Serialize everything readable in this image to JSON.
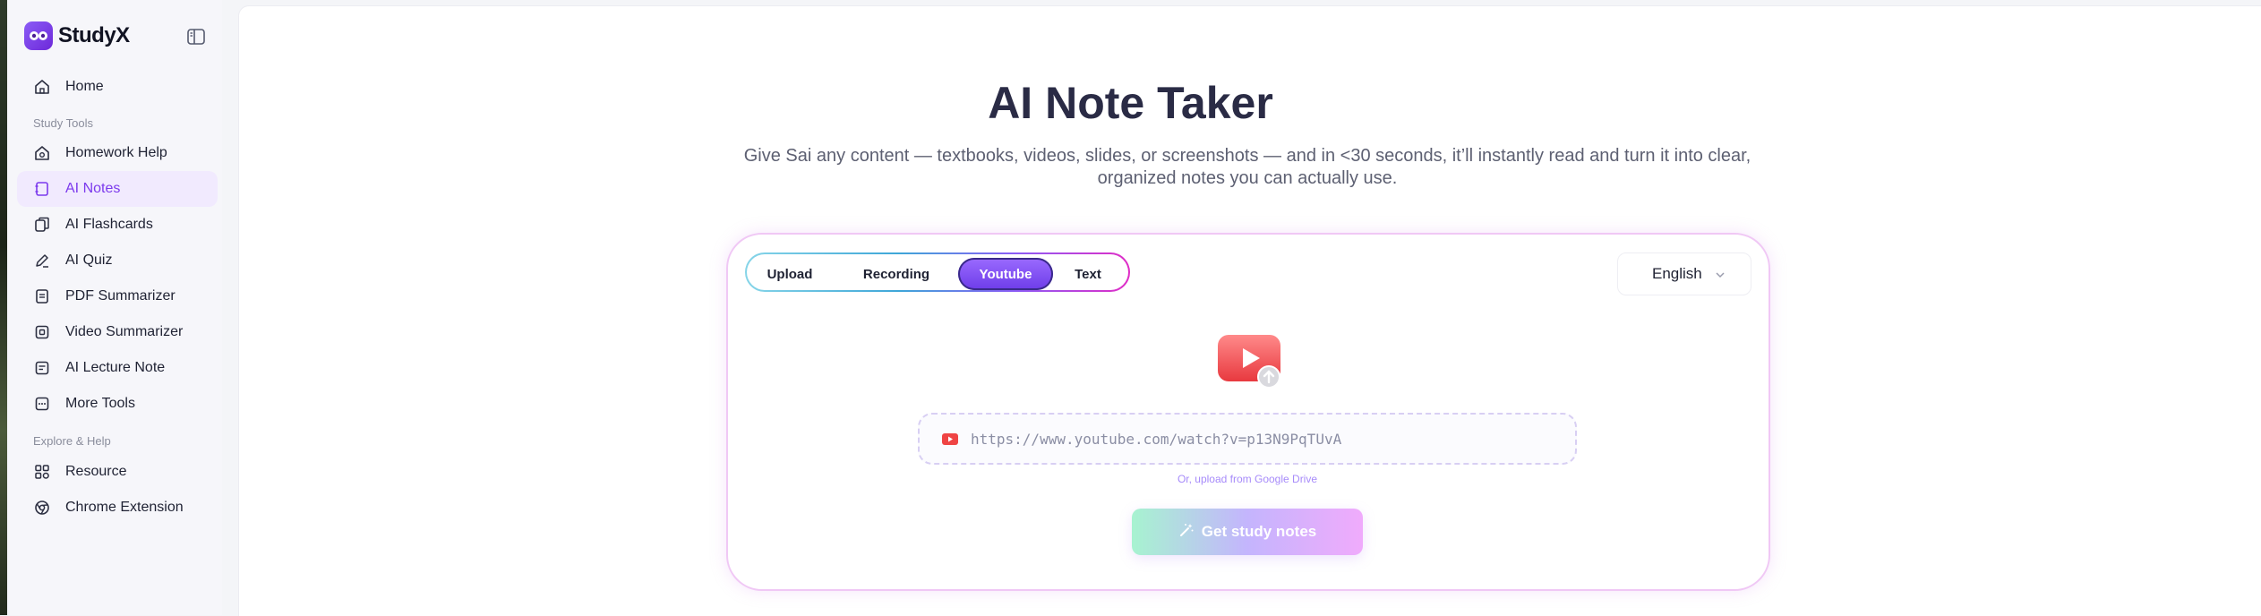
{
  "app": {
    "name": "StudyX"
  },
  "sidebar": {
    "items_top": [
      {
        "label": "Home",
        "icon": "home-icon"
      }
    ],
    "section_study": "Study Tools",
    "items_study": [
      {
        "label": "Homework Help",
        "icon": "homework-icon"
      },
      {
        "label": "AI Notes",
        "icon": "notes-icon",
        "active": true
      },
      {
        "label": "AI Flashcards",
        "icon": "flashcards-icon"
      },
      {
        "label": "AI Quiz",
        "icon": "quiz-pen-icon"
      },
      {
        "label": "PDF Summarizer",
        "icon": "pdf-icon"
      },
      {
        "label": "Video Summarizer",
        "icon": "video-icon"
      },
      {
        "label": "AI Lecture Note",
        "icon": "lecture-note-icon"
      },
      {
        "label": "More Tools",
        "icon": "more-tools-icon"
      }
    ],
    "section_explore": "Explore & Help",
    "items_explore": [
      {
        "label": "Resource",
        "icon": "resource-grid-icon"
      },
      {
        "label": "Chrome Extension",
        "icon": "chrome-icon"
      }
    ]
  },
  "main": {
    "title": "AI Note Taker",
    "subtitle_line1": "Give Sai any content — textbooks, videos, slides, or screenshots — and in <30 seconds, it’ll instantly read and turn it into clear,",
    "subtitle_line2": "organized notes you can actually use.",
    "tabs": [
      {
        "label": "Upload"
      },
      {
        "label": "Recording"
      },
      {
        "label": "Youtube",
        "active": true
      },
      {
        "label": "Text"
      }
    ],
    "language": "English",
    "url_placeholder": "https://www.youtube.com/watch?v=p13N9PqTUvA",
    "gdrive_text": "Or, upload from Google Drive",
    "cta_label": "Get study notes"
  },
  "colors": {
    "accent": "#7c3aed",
    "youtube_red": "#ef4444",
    "active_nav_bg": "#f1eafe"
  }
}
